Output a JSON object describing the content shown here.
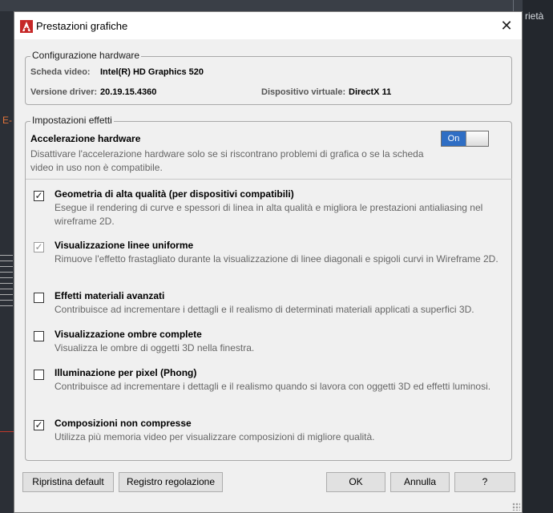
{
  "background": {
    "right_label": "rietà",
    "edge_label": "E-"
  },
  "dialog": {
    "title": "Prestazioni grafiche",
    "close_symbol": "✕",
    "icon": "autocad-logo-icon"
  },
  "hardware": {
    "legend": "Configurazione hardware",
    "video_card_label": "Scheda video:",
    "video_card_value": "Intel(R) HD Graphics 520",
    "driver_label": "Versione driver:",
    "driver_value": "20.19.15.4360",
    "virtual_device_label": "Dispositivo virtuale:",
    "virtual_device_value": "DirectX 11"
  },
  "effects": {
    "legend": "Impostazioni effetti",
    "accel_title": "Accelerazione hardware",
    "accel_desc": "Disattivare l'accelerazione hardware solo se si riscontrano problemi di grafica o se la scheda video in uso non è compatibile.",
    "toggle_label": "On",
    "options": [
      {
        "title": "Geometria di alta qualità (per dispositivi compatibili)",
        "desc": "Esegue il rendering di curve e spessori di linea in alta qualità e migliora le prestazioni antialiasing nel wireframe 2D.",
        "mark": "✓"
      },
      {
        "title": "Visualizzazione linee uniforme",
        "desc": "Rimuove l'effetto frastagliato durante la visualizzazione di linee diagonali e spigoli curvi in Wireframe 2D.",
        "mark": "✓"
      },
      {
        "title": "Effetti materiali avanzati",
        "desc": "Contribuisce ad incrementare i dettagli e il realismo di determinati materiali applicati a superfici 3D.",
        "mark": ""
      },
      {
        "title": "Visualizzazione ombre complete",
        "desc": "Visualizza le ombre di oggetti 3D nella finestra.",
        "mark": ""
      },
      {
        "title": "Illuminazione per pixel (Phong)",
        "desc": "Contribuisce ad incrementare i dettagli e il realismo quando si lavora con oggetti 3D ed effetti luminosi.",
        "mark": ""
      },
      {
        "title": "Composizioni non compresse",
        "desc": "Utilizza più memoria video per visualizzare composizioni di migliore qualità.",
        "mark": "✓"
      }
    ]
  },
  "buttons": {
    "reset": "Ripristina default",
    "log": "Registro regolazione",
    "ok": "OK",
    "cancel": "Annulla",
    "help": "?"
  }
}
